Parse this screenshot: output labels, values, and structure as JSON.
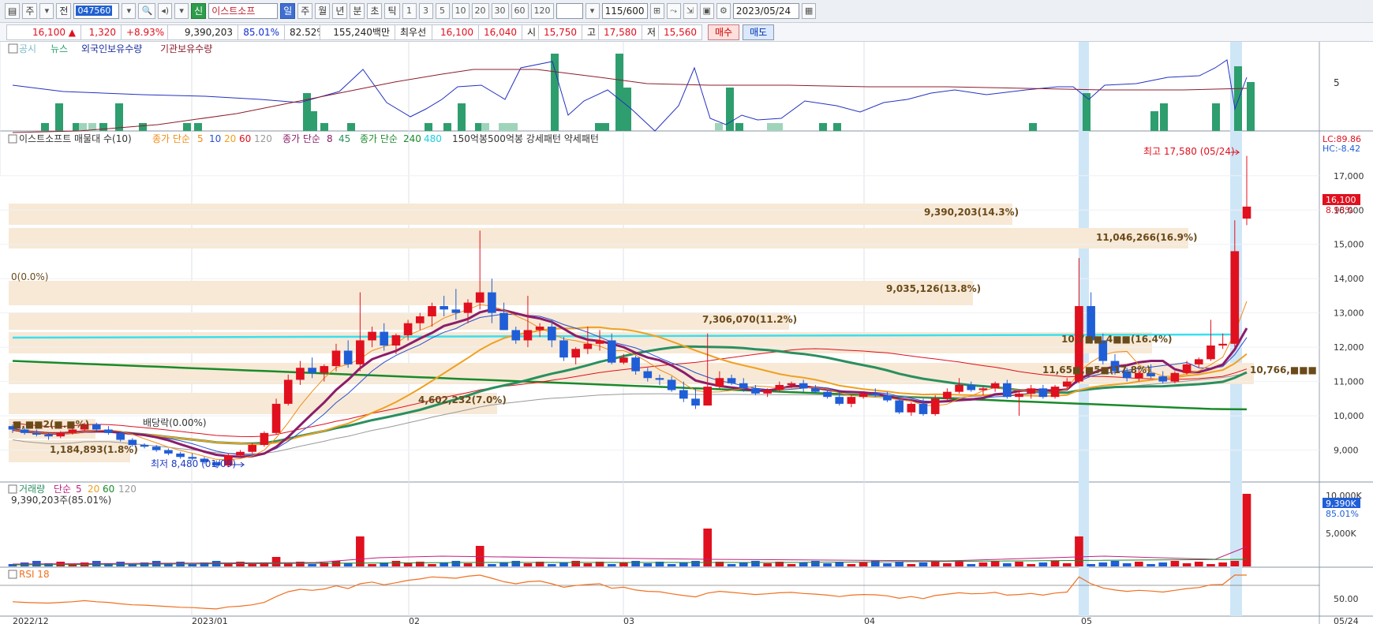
{
  "toolbar": {
    "buttons_left": [
      "주",
      "전"
    ],
    "code": "047560",
    "badge": "신",
    "name": "이스트소프",
    "periods": [
      "일",
      "주",
      "월",
      "년",
      "분",
      "초",
      "틱"
    ],
    "period_active": "일",
    "intervals": [
      "1",
      "3",
      "5",
      "10",
      "20",
      "30",
      "60",
      "120"
    ],
    "count": "115/600",
    "date": "2023/05/24"
  },
  "quote": {
    "price": "16,100 ▲",
    "change": "1,320",
    "change_pct": "+8.93%",
    "volume": "9,390,203",
    "vol_pct1": "85.01%",
    "vol_pct2": "82.52%",
    "amount": "155,240백만",
    "prio_label": "최우선",
    "prio_sell": "16,100",
    "prio_buy": "16,040",
    "open_label": "시",
    "open": "15,750",
    "high_label": "고",
    "high": "17,580",
    "low_label": "저",
    "low": "15,560",
    "buy_label": "매수",
    "sell_label": "매도"
  },
  "panel1": {
    "legend": [
      "공시",
      "뉴스",
      "외국인보유수량",
      "기관보유수량"
    ],
    "axis_label": "5"
  },
  "panel2": {
    "legend": {
      "title": "이스트소프트 매물대 수(10)",
      "ma_short": "종가 단순",
      "ma_short_periods": [
        "5",
        "10",
        "20",
        "60",
        "120"
      ],
      "ma_mid": "종가 단순",
      "ma_mid_periods": [
        "8",
        "45"
      ],
      "ma_long": "종가 단순",
      "ma_long_periods": [
        "240",
        "480"
      ],
      "patterns": "150억봉500억봉 강세패턴  약세패턴"
    },
    "lc": "LC:89.86",
    "hc": "HC:-8.42",
    "max_label": "최고 17,580 (05/24)",
    "min_label": "최저 8,480 (01/09)",
    "price_tag": "16,100",
    "pct_tag": "8.93%",
    "zero_label": "0(0.0%)",
    "dividend_label": "배당락(0.00%)",
    "y_ticks": [
      "17,000",
      "16,000",
      "15,000",
      "14,000",
      "13,000",
      "12,000",
      "11,000",
      "10,000",
      "9,000"
    ],
    "volume_profile": [
      {
        "label": "9,390,203(14.3%)"
      },
      {
        "label": "11,046,266(16.9%)"
      },
      {
        "label": "9,035,126(13.8%)"
      },
      {
        "label": "7,306,070(11.2%)"
      },
      {
        "label": "10,7■■,4■■(16.4%)"
      },
      {
        "label": "11,65■,■5■(17.8%)"
      },
      {
        "label": "10,766,■■■"
      },
      {
        "label": "4,602,232(7.0%)"
      },
      {
        "label": "1,184,893(1.8%)"
      },
      {
        "label": "■,■■2(■.■%)"
      }
    ]
  },
  "panel3": {
    "legend": [
      "거래량",
      "단순",
      "5",
      "20",
      "60",
      "120"
    ],
    "sub": "9,390,203주(85.01%)",
    "tag": "9,390K",
    "tag_pct": "85.01%",
    "ticks": [
      "10,000K",
      "5,000K"
    ]
  },
  "panel4": {
    "legend": "RSI 18",
    "tick": "50.00"
  },
  "x_axis": [
    "2022/12",
    "2023/01",
    "02",
    "03",
    "04",
    "05",
    "05/24"
  ],
  "colors": {
    "up": "#e0101e",
    "down": "#1f5ed6",
    "band": "#f7e9d6",
    "highlight": "#cfe6f7"
  },
  "chart_data": {
    "type": "candlestick",
    "price_range": [
      8300,
      17800
    ],
    "candles": [
      [
        9700,
        9750,
        9500,
        9600
      ],
      [
        9600,
        9650,
        9450,
        9500
      ],
      [
        9500,
        9600,
        9400,
        9450
      ],
      [
        9450,
        9500,
        9300,
        9400
      ],
      [
        9400,
        9550,
        9350,
        9500
      ],
      [
        9500,
        9650,
        9450,
        9600
      ],
      [
        9600,
        9800,
        9550,
        9750
      ],
      [
        9750,
        9800,
        9550,
        9600
      ],
      [
        9600,
        9700,
        9450,
        9500
      ],
      [
        9500,
        9550,
        9250,
        9300
      ],
      [
        9300,
        9350,
        9100,
        9150
      ],
      [
        9150,
        9200,
        9050,
        9100
      ],
      [
        9100,
        9150,
        8950,
        9000
      ],
      [
        9000,
        9050,
        8850,
        8900
      ],
      [
        8900,
        8950,
        8750,
        8800
      ],
      [
        8800,
        8900,
        8700,
        8750
      ],
      [
        8750,
        8800,
        8600,
        8650
      ],
      [
        8650,
        8700,
        8480,
        8550
      ],
      [
        8550,
        8900,
        8500,
        8850
      ],
      [
        8850,
        9000,
        8800,
        8950
      ],
      [
        8950,
        9200,
        8900,
        9150
      ],
      [
        9150,
        9550,
        9100,
        9500
      ],
      [
        9500,
        10500,
        9450,
        10350
      ],
      [
        10350,
        11200,
        10300,
        11050
      ],
      [
        11050,
        11600,
        10900,
        11400
      ],
      [
        11400,
        11700,
        11100,
        11250
      ],
      [
        11250,
        11500,
        11000,
        11450
      ],
      [
        11450,
        12100,
        11300,
        11900
      ],
      [
        11900,
        12200,
        11400,
        11500
      ],
      [
        11500,
        13600,
        11300,
        12200
      ],
      [
        12200,
        12600,
        12000,
        12450
      ],
      [
        12450,
        12700,
        11900,
        12050
      ],
      [
        12050,
        12400,
        11800,
        12350
      ],
      [
        12350,
        12800,
        12200,
        12700
      ],
      [
        12700,
        13000,
        12500,
        12900
      ],
      [
        12900,
        13300,
        12600,
        13200
      ],
      [
        13200,
        13500,
        12900,
        13100
      ],
      [
        13100,
        13700,
        12800,
        13000
      ],
      [
        13000,
        13400,
        12700,
        13300
      ],
      [
        13300,
        15400,
        13100,
        13600
      ],
      [
        13600,
        14000,
        12700,
        13000
      ],
      [
        13000,
        13300,
        12500,
        12500
      ],
      [
        12500,
        12600,
        12100,
        12200
      ],
      [
        12200,
        13500,
        12000,
        12500
      ],
      [
        12500,
        12700,
        12300,
        12600
      ],
      [
        12600,
        12800,
        12000,
        12200
      ],
      [
        12200,
        12300,
        11600,
        11700
      ],
      [
        11700,
        12000,
        11500,
        11950
      ],
      [
        11950,
        12600,
        11800,
        12100
      ],
      [
        12100,
        12500,
        11900,
        12200
      ],
      [
        12200,
        12400,
        11500,
        11550
      ],
      [
        11550,
        11800,
        11500,
        11700
      ],
      [
        11700,
        11750,
        11200,
        11300
      ],
      [
        11300,
        11400,
        11000,
        11100
      ],
      [
        11100,
        11200,
        10900,
        11050
      ],
      [
        11050,
        11150,
        10700,
        10750
      ],
      [
        10750,
        11000,
        10400,
        10500
      ],
      [
        10500,
        10800,
        10200,
        10300
      ],
      [
        10300,
        12400,
        10300,
        10850
      ],
      [
        10850,
        11300,
        10800,
        11100
      ],
      [
        11100,
        11200,
        10900,
        10950
      ],
      [
        10950,
        11100,
        10700,
        10800
      ],
      [
        10800,
        10900,
        10600,
        10650
      ],
      [
        10650,
        10800,
        10550,
        10750
      ],
      [
        10750,
        11000,
        10700,
        10900
      ],
      [
        10900,
        11000,
        10800,
        10950
      ],
      [
        10950,
        11050,
        10700,
        10800
      ],
      [
        10800,
        10900,
        10650,
        10700
      ],
      [
        10700,
        10750,
        10500,
        10550
      ],
      [
        10550,
        10700,
        10300,
        10350
      ],
      [
        10350,
        10600,
        10250,
        10550
      ],
      [
        10550,
        10700,
        10500,
        10650
      ],
      [
        10650,
        10800,
        10550,
        10600
      ],
      [
        10600,
        10700,
        10400,
        10450
      ],
      [
        10450,
        10550,
        10050,
        10100
      ],
      [
        10100,
        10400,
        10000,
        10350
      ],
      [
        10350,
        10500,
        10000,
        10050
      ],
      [
        10050,
        10600,
        10000,
        10500
      ],
      [
        10500,
        10800,
        10450,
        10700
      ],
      [
        10700,
        11100,
        10650,
        10900
      ],
      [
        10900,
        11000,
        10700,
        10750
      ],
      [
        10750,
        10850,
        10600,
        10800
      ],
      [
        10800,
        11000,
        10700,
        10950
      ],
      [
        10950,
        11050,
        10500,
        10550
      ],
      [
        10550,
        10750,
        10000,
        10650
      ],
      [
        10650,
        10900,
        10500,
        10800
      ],
      [
        10800,
        10900,
        10500,
        10550
      ],
      [
        10550,
        10900,
        10500,
        10850
      ],
      [
        10850,
        11100,
        10800,
        11000
      ],
      [
        11000,
        14600,
        10950,
        13200
      ],
      [
        13200,
        13600,
        12100,
        12200
      ],
      [
        12200,
        12400,
        11500,
        11600
      ],
      [
        11600,
        11800,
        11200,
        11300
      ],
      [
        11300,
        11400,
        11000,
        11100
      ],
      [
        11100,
        11350,
        11000,
        11250
      ],
      [
        11250,
        11500,
        11100,
        11150
      ],
      [
        11150,
        11300,
        10950,
        11000
      ],
      [
        11000,
        11300,
        10950,
        11250
      ],
      [
        11250,
        11600,
        11200,
        11500
      ],
      [
        11500,
        11700,
        11400,
        11650
      ],
      [
        11650,
        12800,
        11600,
        12050
      ],
      [
        12050,
        12400,
        11950,
        12100
      ],
      [
        12100,
        15700,
        12000,
        14800
      ],
      [
        15750,
        17580,
        15560,
        16100
      ]
    ],
    "volume_highlight": [
      {
        "index": 104,
        "value": 9390203
      }
    ]
  }
}
